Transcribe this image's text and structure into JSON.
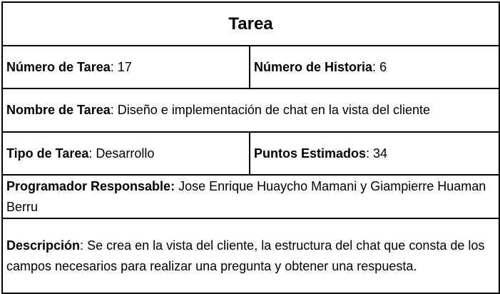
{
  "card": {
    "title": "Tarea",
    "numero_tarea": {
      "label": "Número de Tarea",
      "sep": ": ",
      "value": "17"
    },
    "numero_historia": {
      "label": "Número de Historia",
      "sep": ": ",
      "value": "6"
    },
    "nombre_tarea": {
      "label": "Nombre de Tarea",
      "sep": ": ",
      "value": "Diseño e implementación de chat en la vista del cliente"
    },
    "tipo_tarea": {
      "label": "Tipo de Tarea",
      "sep": ": ",
      "value": "Desarrollo"
    },
    "puntos_estimados": {
      "label": "Puntos Estimados",
      "sep": ": ",
      "value": "34"
    },
    "programador": {
      "label": "Programador Responsable:",
      "sep": " ",
      "value": "Jose Enrique Huaycho Mamani y Giampierre Huaman Berru"
    },
    "descripcion": {
      "label": "Descripción",
      "sep": ": ",
      "value": "Se crea en la vista del cliente, la estructura del chat que consta de los campos necesarios para realizar una pregunta y obtener una respuesta."
    }
  }
}
